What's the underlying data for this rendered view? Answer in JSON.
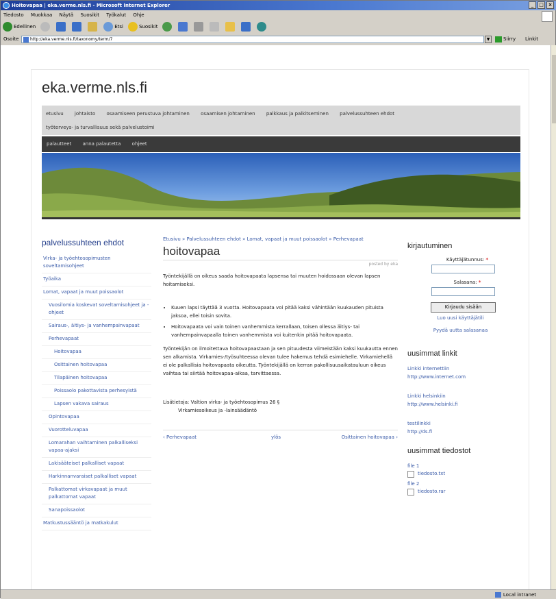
{
  "browser": {
    "title": "Hoitovapaa | eka.verme.nls.fi - Microsoft Internet Explorer",
    "menu": [
      "Tiedosto",
      "Muokkaa",
      "Näytä",
      "Suosikit",
      "Työkalut",
      "Ohje"
    ],
    "toolbar": {
      "back": "Edellinen",
      "search": "Etsi",
      "favorites": "Suosikit"
    },
    "address_label": "Osoite",
    "address_value": "http://eka.verme.nls.fi/taxonomy/term/7",
    "go_label": "Siirry",
    "links_label": "Linkit",
    "status_zone": "Local intranet"
  },
  "site": {
    "title": "eka.verme.nls.fi",
    "nav_row1": [
      "etusivu",
      "johtaisto",
      "osaamiseen perustuva johtaminen",
      "osaamisen johtaminen",
      "palkkaus ja palkitseminen",
      "palvelussuhteen ehdot"
    ],
    "nav_row2": [
      "työterveys- ja turvallisuus sekä palvelustoimi"
    ],
    "nav2": [
      "palautteet",
      "anna palautetta",
      "ohjeet"
    ]
  },
  "left": {
    "heading": "palvelussuhteen ehdot",
    "items": [
      {
        "label": "Virka- ja työehtosopimusten soveltamisohjeet",
        "level": 0
      },
      {
        "label": "Työaika",
        "level": 0
      },
      {
        "label": "Lomat, vapaat ja muut poissaolot",
        "level": 0
      },
      {
        "label": "Vuosilomia koskevat soveltamisohjeet ja -ohjeet",
        "level": 1
      },
      {
        "label": "Sairaus-, äitiys- ja vanhempainvapaat",
        "level": 1
      },
      {
        "label": "Perhevapaat",
        "level": 1
      },
      {
        "label": "Hoitovapaa",
        "level": 2
      },
      {
        "label": "Osittainen hoitovapaa",
        "level": 2
      },
      {
        "label": "Tilapäinen hoitovapaa",
        "level": 2
      },
      {
        "label": "Poissaolo pakottavista perhesyistä",
        "level": 2
      },
      {
        "label": "Lapsen vakava sairaus",
        "level": 2
      },
      {
        "label": "Opintovapaa",
        "level": 1
      },
      {
        "label": "Vuorotteluvapaa",
        "level": 1
      },
      {
        "label": "Lomarahan vaihtaminen palkalliseksi vapaa-ajaksi",
        "level": 1
      },
      {
        "label": "Lakisääteiset palkalliset vapaat",
        "level": 1
      },
      {
        "label": "Harkinnanvaraiset palkalliset vapaat",
        "level": 1
      },
      {
        "label": "Palkattomat virkavapaat ja muut palkattomat vapaat",
        "level": 1
      },
      {
        "label": "Sanapoissaolot",
        "level": 1
      },
      {
        "label": "Matkustussääntö ja matkakulut",
        "level": 0
      }
    ]
  },
  "main": {
    "breadcrumb": "Etusivu » Palvelussuhteen ehdot » Lomat, vapaat ja muut poissaolot » Perhevapaat",
    "title": "hoitovapaa",
    "posted": "posted by eka",
    "intro": "Työntekijällä on oikeus saada hoitovapaata lapsensa tai muuten hoidossaan olevan lapsen hoitamiseksi.",
    "bullets": [
      "Kuuen lapsi täyttää 3 vuotta. Hoitovapaata voi pitää kaksi vähintään kuukauden pituista jaksoa, ellei toisin sovita.",
      "Hoitovapaata voi vain toinen vanhemmista kerrallaan, toisen ollessa äitiys- tai vanhempainvapaalla toinen vanhemmista voi kuitenkin pitää hoitovapaata."
    ],
    "para2": "Työntekijän on ilmoitettava hoitovapaastaan ja sen pituudesta viimeistään kaksi kuukautta ennen sen alkamista. Virkamies-/työsuhteessa olevan tulee hakemus tehdä esimiehelle. Virkamiehellä ei ole palkallisia hoitovapaata oikeutta. Työntekijällä on kerran pakollisuusaikatauluun oikeus vaihtaa tai siirtää hoitovapaa-aikaa, tarvittaessa.",
    "ref_line1": "Lisätietoja: Valtion virka- ja työehtosopimus 26 §",
    "ref_line2": "Virkamiesoikeus ja -lainsäädäntö",
    "bottom_nav": {
      "prev": "‹ Perhevapaat",
      "up": "ylös",
      "next": "Osittainen hoitovapaa ›"
    }
  },
  "right": {
    "login_heading": "kirjautuminen",
    "username_label": "Käyttäjätunnus:",
    "password_label": "Salasana:",
    "required_mark": "*",
    "login_button": "Kirjaudu sisään",
    "register_link": "Luo uusi käyttäjätili",
    "forgot_link": "Pyydä uutta salasanaa",
    "links_heading": "uusimmat linkit",
    "links": [
      {
        "title": "Linkki internettiin",
        "url": "http://www.internet.com"
      },
      {
        "title": "Linkki helsinkiin",
        "url": "http://www.helsinki.fi"
      },
      {
        "title": "testilinkki",
        "url": "http://ds.fi"
      }
    ],
    "files_heading": "uusimmat tiedostot",
    "files": [
      {
        "label": "file 1",
        "filename": "tiedosto.txt"
      },
      {
        "label": "file 2",
        "filename": "tiedosto.rar"
      }
    ]
  },
  "colors": {
    "link": "#3a5ba8",
    "heading_blue": "#223d8a",
    "nav_dark": "#3a3a3a",
    "nav_light": "#d8d8d8",
    "titlebar": "#1f3f9a"
  }
}
